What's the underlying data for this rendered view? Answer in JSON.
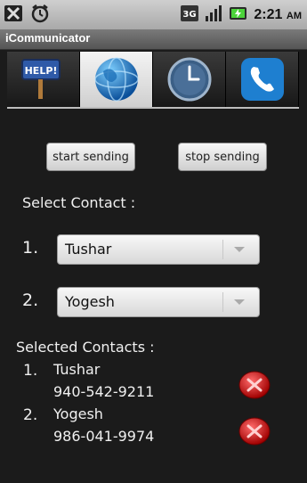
{
  "status_bar": {
    "left_icons": [
      "notification-x-icon",
      "alarm-clock-icon"
    ],
    "right_icons": [
      "3g-network-icon",
      "signal-strength-icon",
      "battery-charging-icon"
    ],
    "time": "2:21",
    "ampm": "AM"
  },
  "app": {
    "title": "iCommunicator"
  },
  "tabs": [
    {
      "name": "help",
      "icon": "help-sign-icon",
      "label": "HELP!"
    },
    {
      "name": "globe",
      "icon": "globe-icon",
      "active": true
    },
    {
      "name": "clock",
      "icon": "clock-icon"
    },
    {
      "name": "phone",
      "icon": "phone-icon"
    }
  ],
  "buttons": {
    "start": "start sending",
    "stop": "stop sending"
  },
  "select_contact": {
    "heading": "Select Contact :",
    "rows": [
      {
        "num": "1.",
        "value": "Tushar"
      },
      {
        "num": "2.",
        "value": "Yogesh"
      }
    ]
  },
  "selected_contacts": {
    "heading": "Selected Contacts :",
    "items": [
      {
        "num": "1.",
        "name": "Tushar",
        "phone": "940-542-9211"
      },
      {
        "num": "2.",
        "name": "Yogesh",
        "phone": "986-041-9974"
      }
    ]
  },
  "colors": {
    "background": "#1b1b1b",
    "delete_button": "#c81414",
    "accent_blue": "#1e7fd0"
  }
}
